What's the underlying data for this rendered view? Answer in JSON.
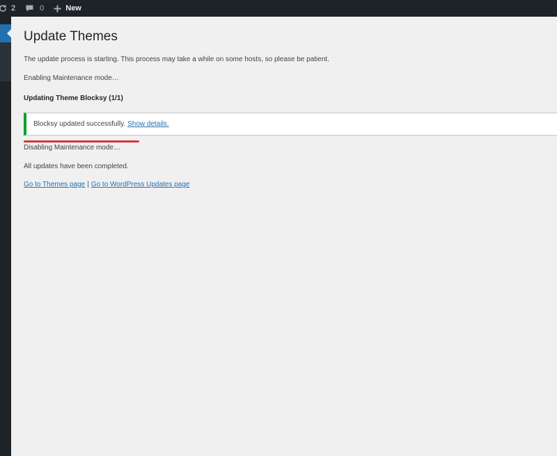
{
  "adminbar": {
    "updates_count": "2",
    "comments_count": "0",
    "new_label": "New"
  },
  "page": {
    "title": "Update Themes",
    "intro": "The update process is starting. This process may take a while on some hosts, so please be patient.",
    "enabling": "Enabling Maintenance mode…",
    "updating": "Updating Theme Blocksy (1/1)",
    "notice": {
      "message": "Blocksy updated successfully.",
      "link": "Show details."
    },
    "disabling": "Disabling Maintenance mode…",
    "completed": "All updates have been completed.",
    "links": {
      "themes": "Go to Themes page",
      "separator": "|",
      "updates": "Go to WordPress Updates page"
    }
  },
  "colors": {
    "adminbar": "#1d2327",
    "accent": "#2271b1",
    "success": "#00a32a",
    "highlight": "#d63638"
  }
}
